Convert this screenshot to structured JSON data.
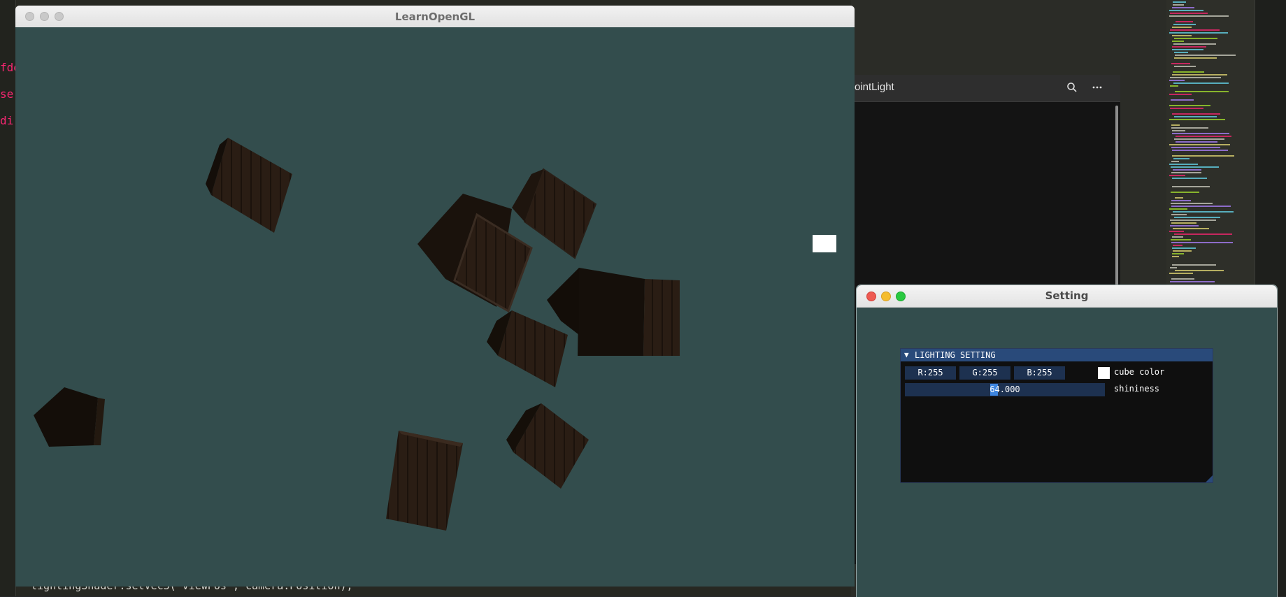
{
  "learnopengl_window": {
    "title": "LearnOpenGL"
  },
  "setting_window": {
    "title": "Setting"
  },
  "pointlight_window": {
    "title": "ointLight"
  },
  "code": {
    "left_fragments": [
      "fde",
      "se",
      "di"
    ],
    "bottom_line": "lightingShader.setVec3(\"viewPos\", camera.Position);"
  },
  "lighting_panel": {
    "header": "LIGHTING SETTING",
    "arrow": "▼",
    "r_value": "R:255",
    "g_value": "G:255",
    "b_value": "B:255",
    "color_label": "cube color",
    "shininess_value": "64.000",
    "shininess_label": "shininess",
    "cube_color_hex": "#ffffff"
  },
  "colors": {
    "gl_clear": "#334d4d",
    "imgui_header": "#294a7a",
    "imgui_field": "#1d3150",
    "mac_close": "#ee5a52",
    "mac_min": "#f5bd2e",
    "mac_max": "#29c940"
  },
  "icons": [
    "search-icon",
    "more-icon",
    "collapse-arrow-icon",
    "light-source-cube-icon"
  ]
}
